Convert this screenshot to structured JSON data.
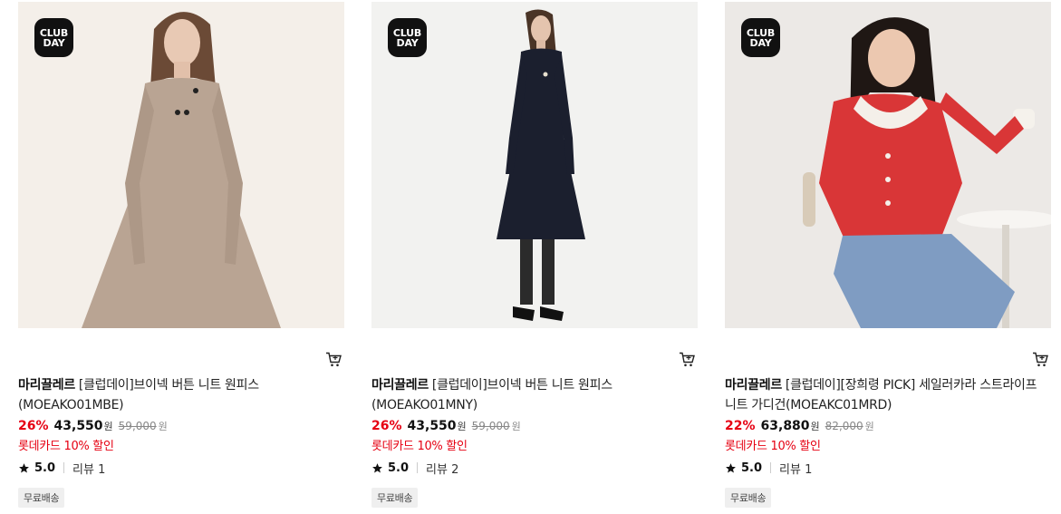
{
  "badge": {
    "line1": "CLUB",
    "line2": "DAY"
  },
  "icons": {
    "cart": "cart-icon",
    "star": "star-icon"
  },
  "colors": {
    "discount": "#e60012",
    "benefit": "#e60012",
    "badge_bg": "#111111"
  },
  "products": [
    {
      "brand": "마리끌레르",
      "title": "[클럽데이]브이넥 버튼 니트 원피스 (MOEAKO01MBE)",
      "discount": "26%",
      "sale_price": "43,550",
      "won": "원",
      "original_price": "59,000",
      "benefit": "롯데카드 10% 할인",
      "rating": "5.0",
      "reviews": "리뷰 1",
      "shipping": "무료배송"
    },
    {
      "brand": "마리끌레르",
      "title": "[클럽데이]브이넥 버튼 니트 원피스 (MOEAKO01MNY)",
      "discount": "26%",
      "sale_price": "43,550",
      "won": "원",
      "original_price": "59,000",
      "benefit": "롯데카드 10% 할인",
      "rating": "5.0",
      "reviews": "리뷰 2",
      "shipping": "무료배송"
    },
    {
      "brand": "마리끌레르",
      "title": "[클럽데이][장희령 PICK] 세일러카라 스트라이프 니트 가디건(MOEAKC01MRD)",
      "discount": "22%",
      "sale_price": "63,880",
      "won": "원",
      "original_price": "82,000",
      "benefit": "롯데카드 10% 할인",
      "rating": "5.0",
      "reviews": "리뷰 1",
      "shipping": "무료배송"
    }
  ]
}
